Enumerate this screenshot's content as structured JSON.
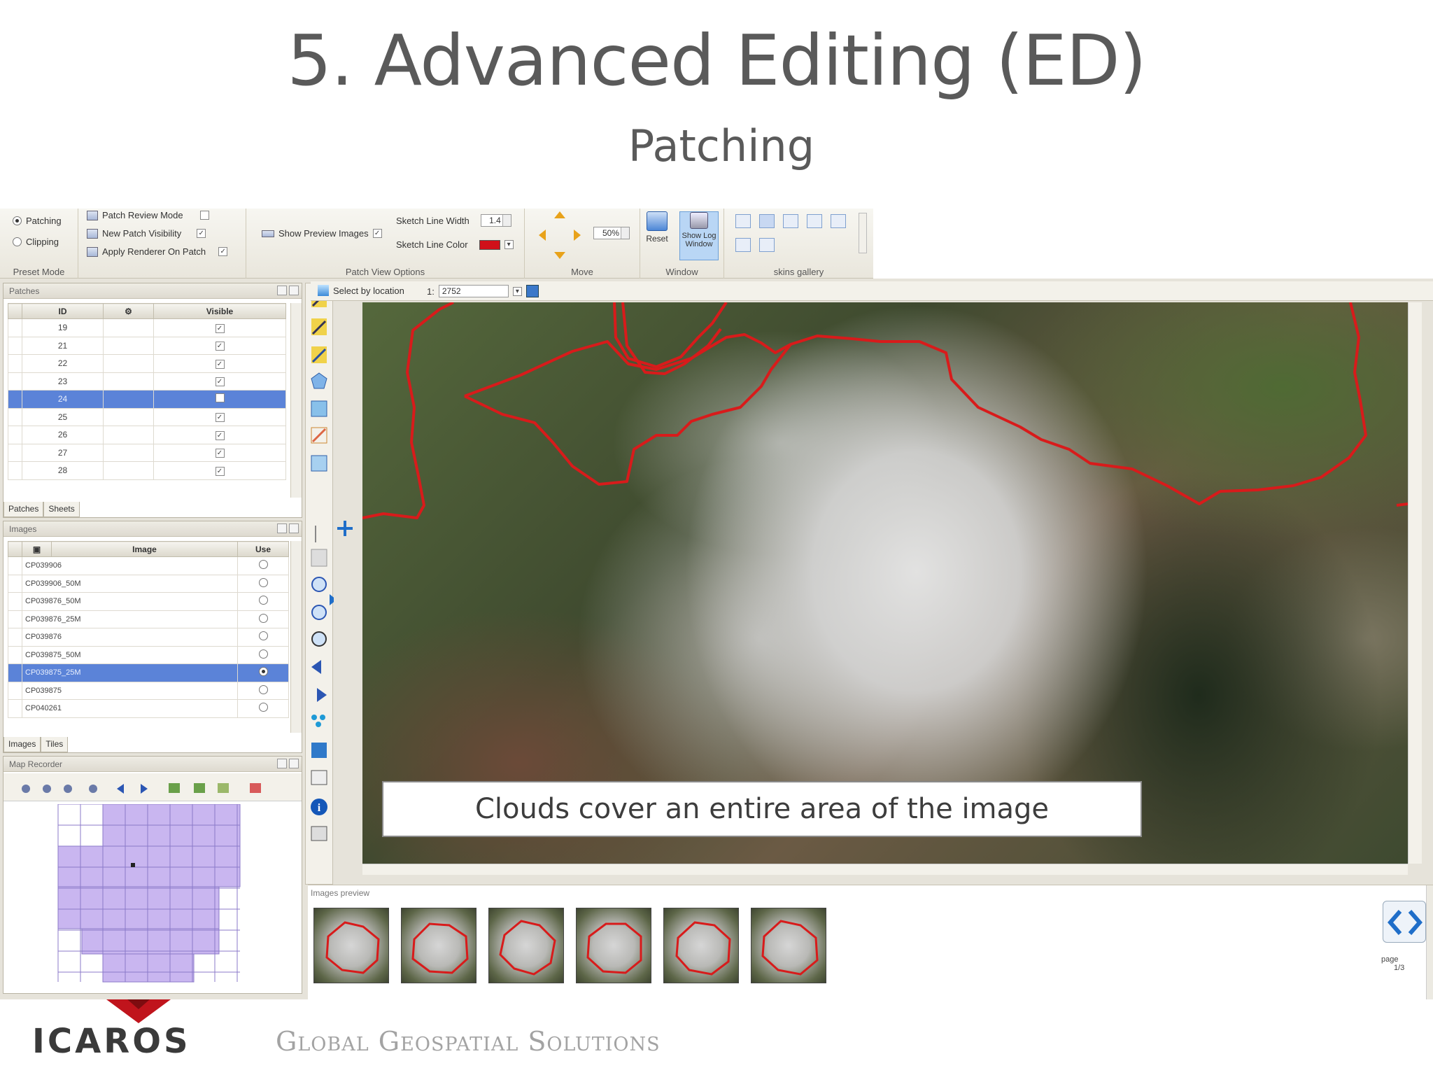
{
  "slide": {
    "title": "5. Advanced Editing (ED)",
    "subtitle": "Patching"
  },
  "ribbon": {
    "preset_mode": {
      "label": "Preset Mode",
      "options": [
        "Patching",
        "Clipping"
      ],
      "selected": "Patching"
    },
    "patch_options": {
      "patch_review_mode": "Patch Review Mode",
      "new_patch_visibility": "New Patch Visibility",
      "apply_renderer": "Apply Renderer On Patch"
    },
    "patch_view_options": {
      "label": "Patch View Options",
      "show_preview_images": "Show Preview Images",
      "sketch_line_width_label": "Sketch Line Width",
      "sketch_line_width_value": "1.4",
      "sketch_line_color_label": "Sketch Line Color",
      "sketch_line_color": "#d0101a"
    },
    "move": {
      "label": "Move",
      "zoom_value": "50%"
    },
    "window": {
      "label": "Window",
      "reset_label": "Reset",
      "show_log_label": "Show Log Window"
    },
    "skins_gallery_label": "skins gallery"
  },
  "patches_panel": {
    "title": "Patches",
    "columns": [
      "ID",
      "Visible"
    ],
    "rows": [
      {
        "id": "19",
        "visible": true
      },
      {
        "id": "21",
        "visible": true
      },
      {
        "id": "22",
        "visible": true
      },
      {
        "id": "23",
        "visible": true
      },
      {
        "id": "24",
        "visible": false,
        "selected": true
      },
      {
        "id": "25",
        "visible": true
      },
      {
        "id": "26",
        "visible": true
      },
      {
        "id": "27",
        "visible": true
      },
      {
        "id": "28",
        "visible": true
      }
    ],
    "tabs": [
      "Patches",
      "Sheets"
    ]
  },
  "images_panel": {
    "title": "Images",
    "columns": [
      "Image",
      "Use"
    ],
    "rows": [
      {
        "name": "CP039906"
      },
      {
        "name": "CP039906_50M"
      },
      {
        "name": "CP039876_50M"
      },
      {
        "name": "CP039876_25M"
      },
      {
        "name": "CP039876"
      },
      {
        "name": "CP039875_50M"
      },
      {
        "name": "CP039875_25M",
        "selected": true
      },
      {
        "name": "CP039875"
      },
      {
        "name": "CP040261"
      }
    ],
    "tabs": [
      "Images",
      "Tiles"
    ]
  },
  "map_recorder_panel": {
    "title": "Map Recorder"
  },
  "map_toolbar": {
    "select_by_location": "Select by location",
    "scale_prefix": "1:",
    "scale_value": "2752"
  },
  "map": {
    "caption": "Clouds cover an entire area of the image",
    "patch_outline_color": "#d81b1b"
  },
  "preview_panel": {
    "title": "Images preview",
    "thumbnail_count": 6,
    "page_label": "page",
    "page_value": "1/3"
  },
  "footer": {
    "logo_text": "ICAROS",
    "tagline": "Global Geospatial Solutions"
  }
}
